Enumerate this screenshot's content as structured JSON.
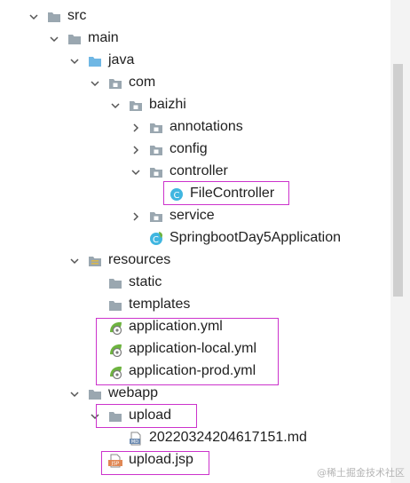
{
  "tree": [
    {
      "depth": 0,
      "arrow": "down",
      "icon": "folder-icon",
      "label": "src"
    },
    {
      "depth": 1,
      "arrow": "down",
      "icon": "folder-icon",
      "label": "main"
    },
    {
      "depth": 2,
      "arrow": "down",
      "icon": "source-folder-icon",
      "label": "java"
    },
    {
      "depth": 3,
      "arrow": "down",
      "icon": "package-icon",
      "label": "com"
    },
    {
      "depth": 4,
      "arrow": "down",
      "icon": "package-icon",
      "label": "baizhi"
    },
    {
      "depth": 5,
      "arrow": "right",
      "icon": "package-icon",
      "label": "annotations"
    },
    {
      "depth": 5,
      "arrow": "right",
      "icon": "package-icon",
      "label": "config"
    },
    {
      "depth": 5,
      "arrow": "down",
      "icon": "package-icon",
      "label": "controller"
    },
    {
      "depth": 6,
      "arrow": "none",
      "icon": "class-icon",
      "label": "FileController"
    },
    {
      "depth": 5,
      "arrow": "right",
      "icon": "package-icon",
      "label": "service"
    },
    {
      "depth": 5,
      "arrow": "none",
      "icon": "spring-class-icon",
      "label": "SpringbootDay5Application"
    },
    {
      "depth": 2,
      "arrow": "down",
      "icon": "resources-folder-icon",
      "label": "resources"
    },
    {
      "depth": 3,
      "arrow": "none",
      "icon": "folder-icon",
      "label": "static"
    },
    {
      "depth": 3,
      "arrow": "none",
      "icon": "folder-icon",
      "label": "templates"
    },
    {
      "depth": 3,
      "arrow": "none",
      "icon": "spring-yml-icon",
      "label": "application.yml"
    },
    {
      "depth": 3,
      "arrow": "none",
      "icon": "spring-yml-icon",
      "label": "application-local.yml"
    },
    {
      "depth": 3,
      "arrow": "none",
      "icon": "spring-yml-icon",
      "label": "application-prod.yml"
    },
    {
      "depth": 2,
      "arrow": "down",
      "icon": "folder-icon",
      "label": "webapp"
    },
    {
      "depth": 3,
      "arrow": "down",
      "icon": "folder-icon",
      "label": "upload"
    },
    {
      "depth": 4,
      "arrow": "none",
      "icon": "markdown-icon",
      "label": "20220324204617151.md"
    },
    {
      "depth": 3,
      "arrow": "none",
      "icon": "jsp-icon",
      "label": "upload.jsp"
    }
  ],
  "watermark": "@稀土掘金技术社区",
  "colors": {
    "highlight": "#cc33cc",
    "folder": "#9aa7b0",
    "source_folder": "#6fb7e4",
    "class": "#40b6e0",
    "spring": "#6db33f",
    "jsp": "#e08855"
  }
}
